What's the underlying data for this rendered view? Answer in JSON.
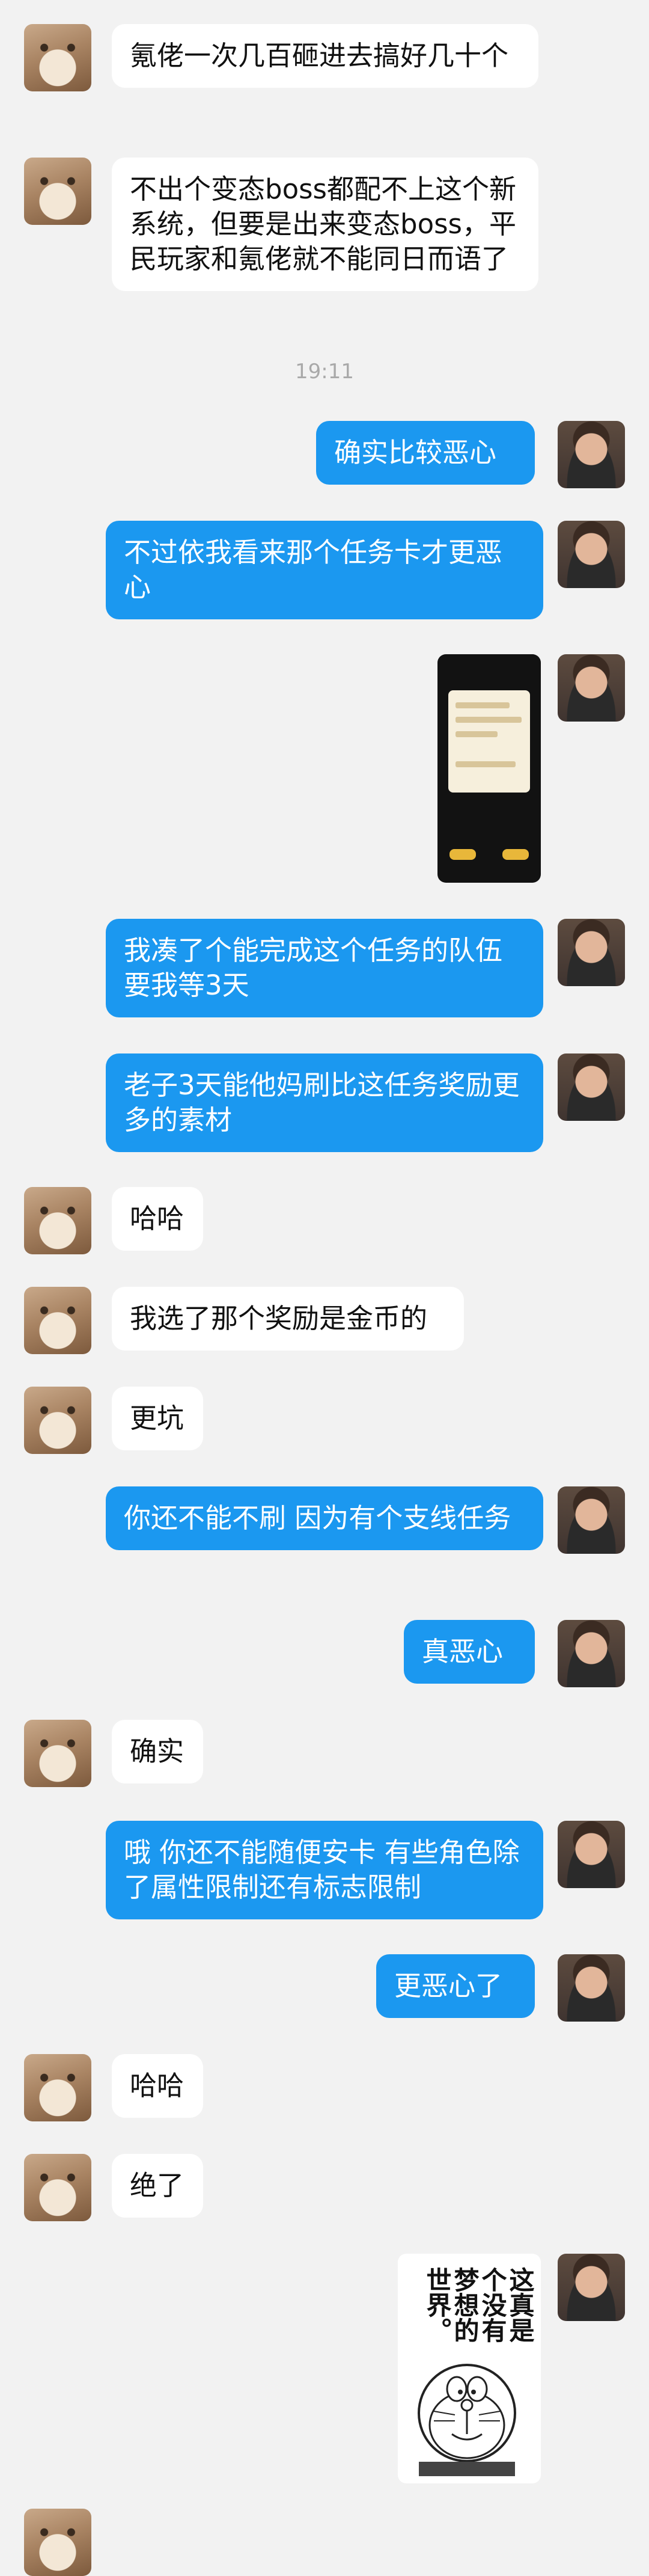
{
  "messages": [
    {
      "text": "氪佬一次几百砸进去搞好几十个"
    },
    {
      "text": "不出个变态boss都配不上这个新系统，但要是出来变态boss，平民玩家和氪佬就不能同日而语了"
    },
    {
      "text": "确实比较恶心"
    },
    {
      "text": "不过依我看来那个任务卡才更恶心"
    },
    {
      "text": "我凑了个能完成这个任务的队伍 要我等3天"
    },
    {
      "text": "老子3天能他妈刷比这任务奖励更多的素材"
    },
    {
      "text": "哈哈"
    },
    {
      "text": "我选了那个奖励是金币的"
    },
    {
      "text": "更坑"
    },
    {
      "text": "你还不能不刷 因为有个支线任务"
    },
    {
      "text": "真恶心"
    },
    {
      "text": "确实"
    },
    {
      "text": "哦 你还不能随便安卡 有些角色除了属性限制还有标志限制"
    },
    {
      "text": "更恶心了"
    },
    {
      "text": "哈哈"
    },
    {
      "text": "绝了"
    }
  ],
  "timestamp": "19:11",
  "image_messages": [
    {
      "kind": "game screenshot"
    },
    {
      "kind": "meme",
      "caption_lines": [
        "这真是",
        "个没有",
        "梦想的",
        "世界。"
      ]
    }
  ],
  "colors": {
    "background": "#f2f2f2",
    "incoming_bubble": "#ffffff",
    "outgoing_bubble": "#1b98f0"
  },
  "icons": {
    "incoming_avatar": "cat-avatar-icon",
    "outgoing_avatar": "man-avatar-icon"
  }
}
